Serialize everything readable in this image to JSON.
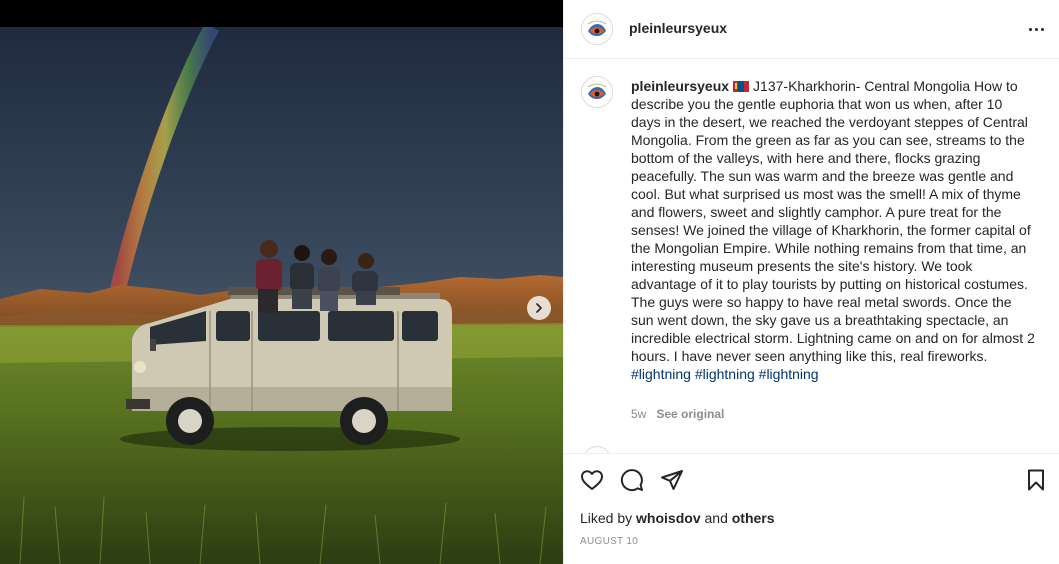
{
  "post": {
    "username": "pleinleursyeux",
    "media_alt": "Children sitting on top of a white van in a green steppe under a stormy sky with a rainbow",
    "caption": {
      "username": "pleinleursyeux",
      "flag": "mongolia-flag",
      "text": "J137-Kharkhorin- Central Mongolia How to describe you the gentle euphoria that won us when, after 10 days in the desert, we reached the verdoyant steppes of Central Mongolia. From the green as far as you can see, streams to the bottom of the valleys, with here and there, flocks grazing peacefully. The sun was warm and the breeze was gentle and cool. But what surprised us most was the smell! A mix of thyme and flowers, sweet and slightly camphor. A pure treat for the senses! We joined the village of Kharkhorin, the former capital of the Mongolian Empire. While nothing remains from that time, an interesting museum presents the site's history. We took advantage of it to play tourists by putting on historical costumes. The guys were so happy to have real metal swords. Once the sun went down, the sky gave us a breathtaking spectacle, an incredible electrical storm. Lightning came on and on for almost 2 hours. I have never seen anything like this, real fireworks.",
      "hashtags": [
        "#lightning",
        "#lightning",
        "#lightning"
      ]
    },
    "age": "5w",
    "see_original": "See original",
    "liked_by_prefix": "Liked by",
    "liked_by_user": "whoisdov",
    "liked_by_and": "and",
    "liked_by_others": "others",
    "date": "AUGUST 10"
  },
  "icons": {
    "more": "more-options-icon",
    "next": "chevron-right-icon",
    "like": "heart-icon",
    "comment": "comment-icon",
    "share": "paper-plane-icon",
    "save": "bookmark-icon"
  },
  "colors": {
    "text": "#262626",
    "secondary": "#8e8e8e",
    "link": "#00376b",
    "divider": "#efefef"
  }
}
